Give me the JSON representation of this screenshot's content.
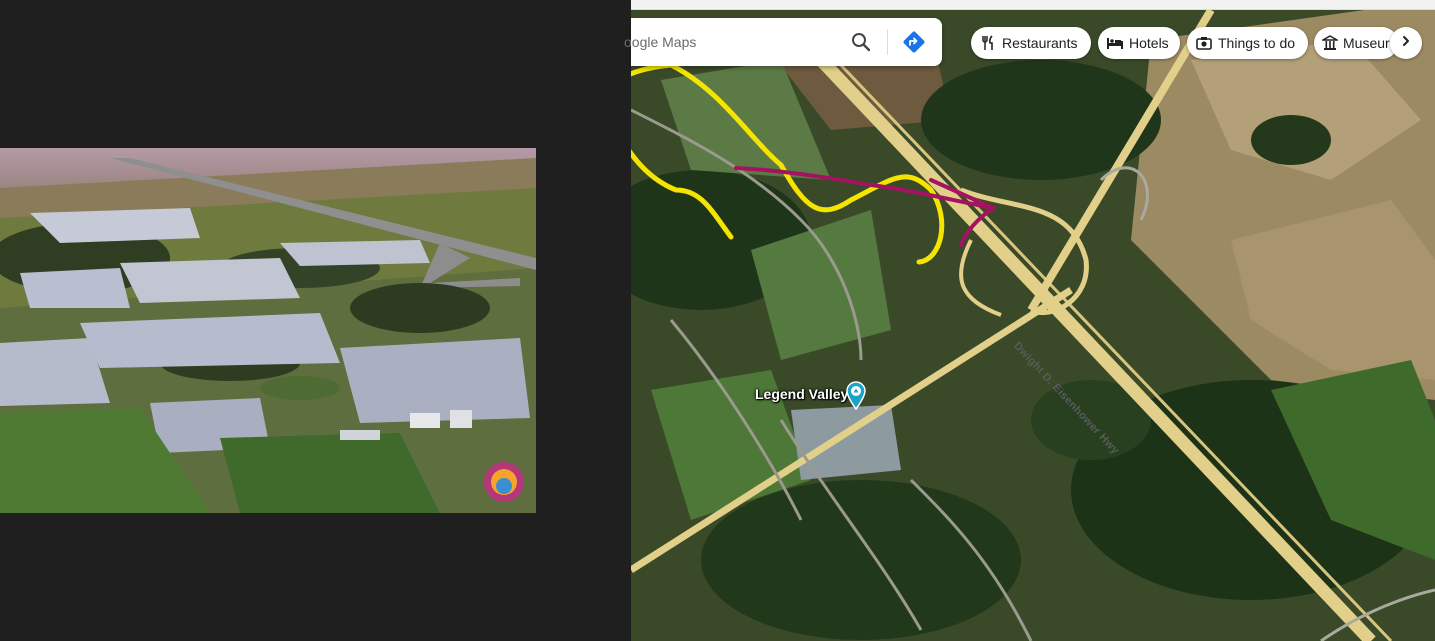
{
  "search": {
    "placeholder": "oogle Maps"
  },
  "chips": [
    {
      "label": "Restaurants",
      "icon": "fork-knife-icon"
    },
    {
      "label": "Hotels",
      "icon": "bed-icon"
    },
    {
      "label": "Things to do",
      "icon": "camera-icon"
    },
    {
      "label": "Museur",
      "icon": "museum-icon"
    }
  ],
  "map": {
    "place_label": "Legend Valley",
    "place_icon": "attraction-pin-icon",
    "road_label": "Dwight D. Eisenhower Hwy"
  },
  "colors": {
    "highway": "#e8d68a",
    "annotation_yellow": "#f5e400",
    "annotation_magenta": "#a3135f",
    "pin": "#1aa3c9"
  }
}
